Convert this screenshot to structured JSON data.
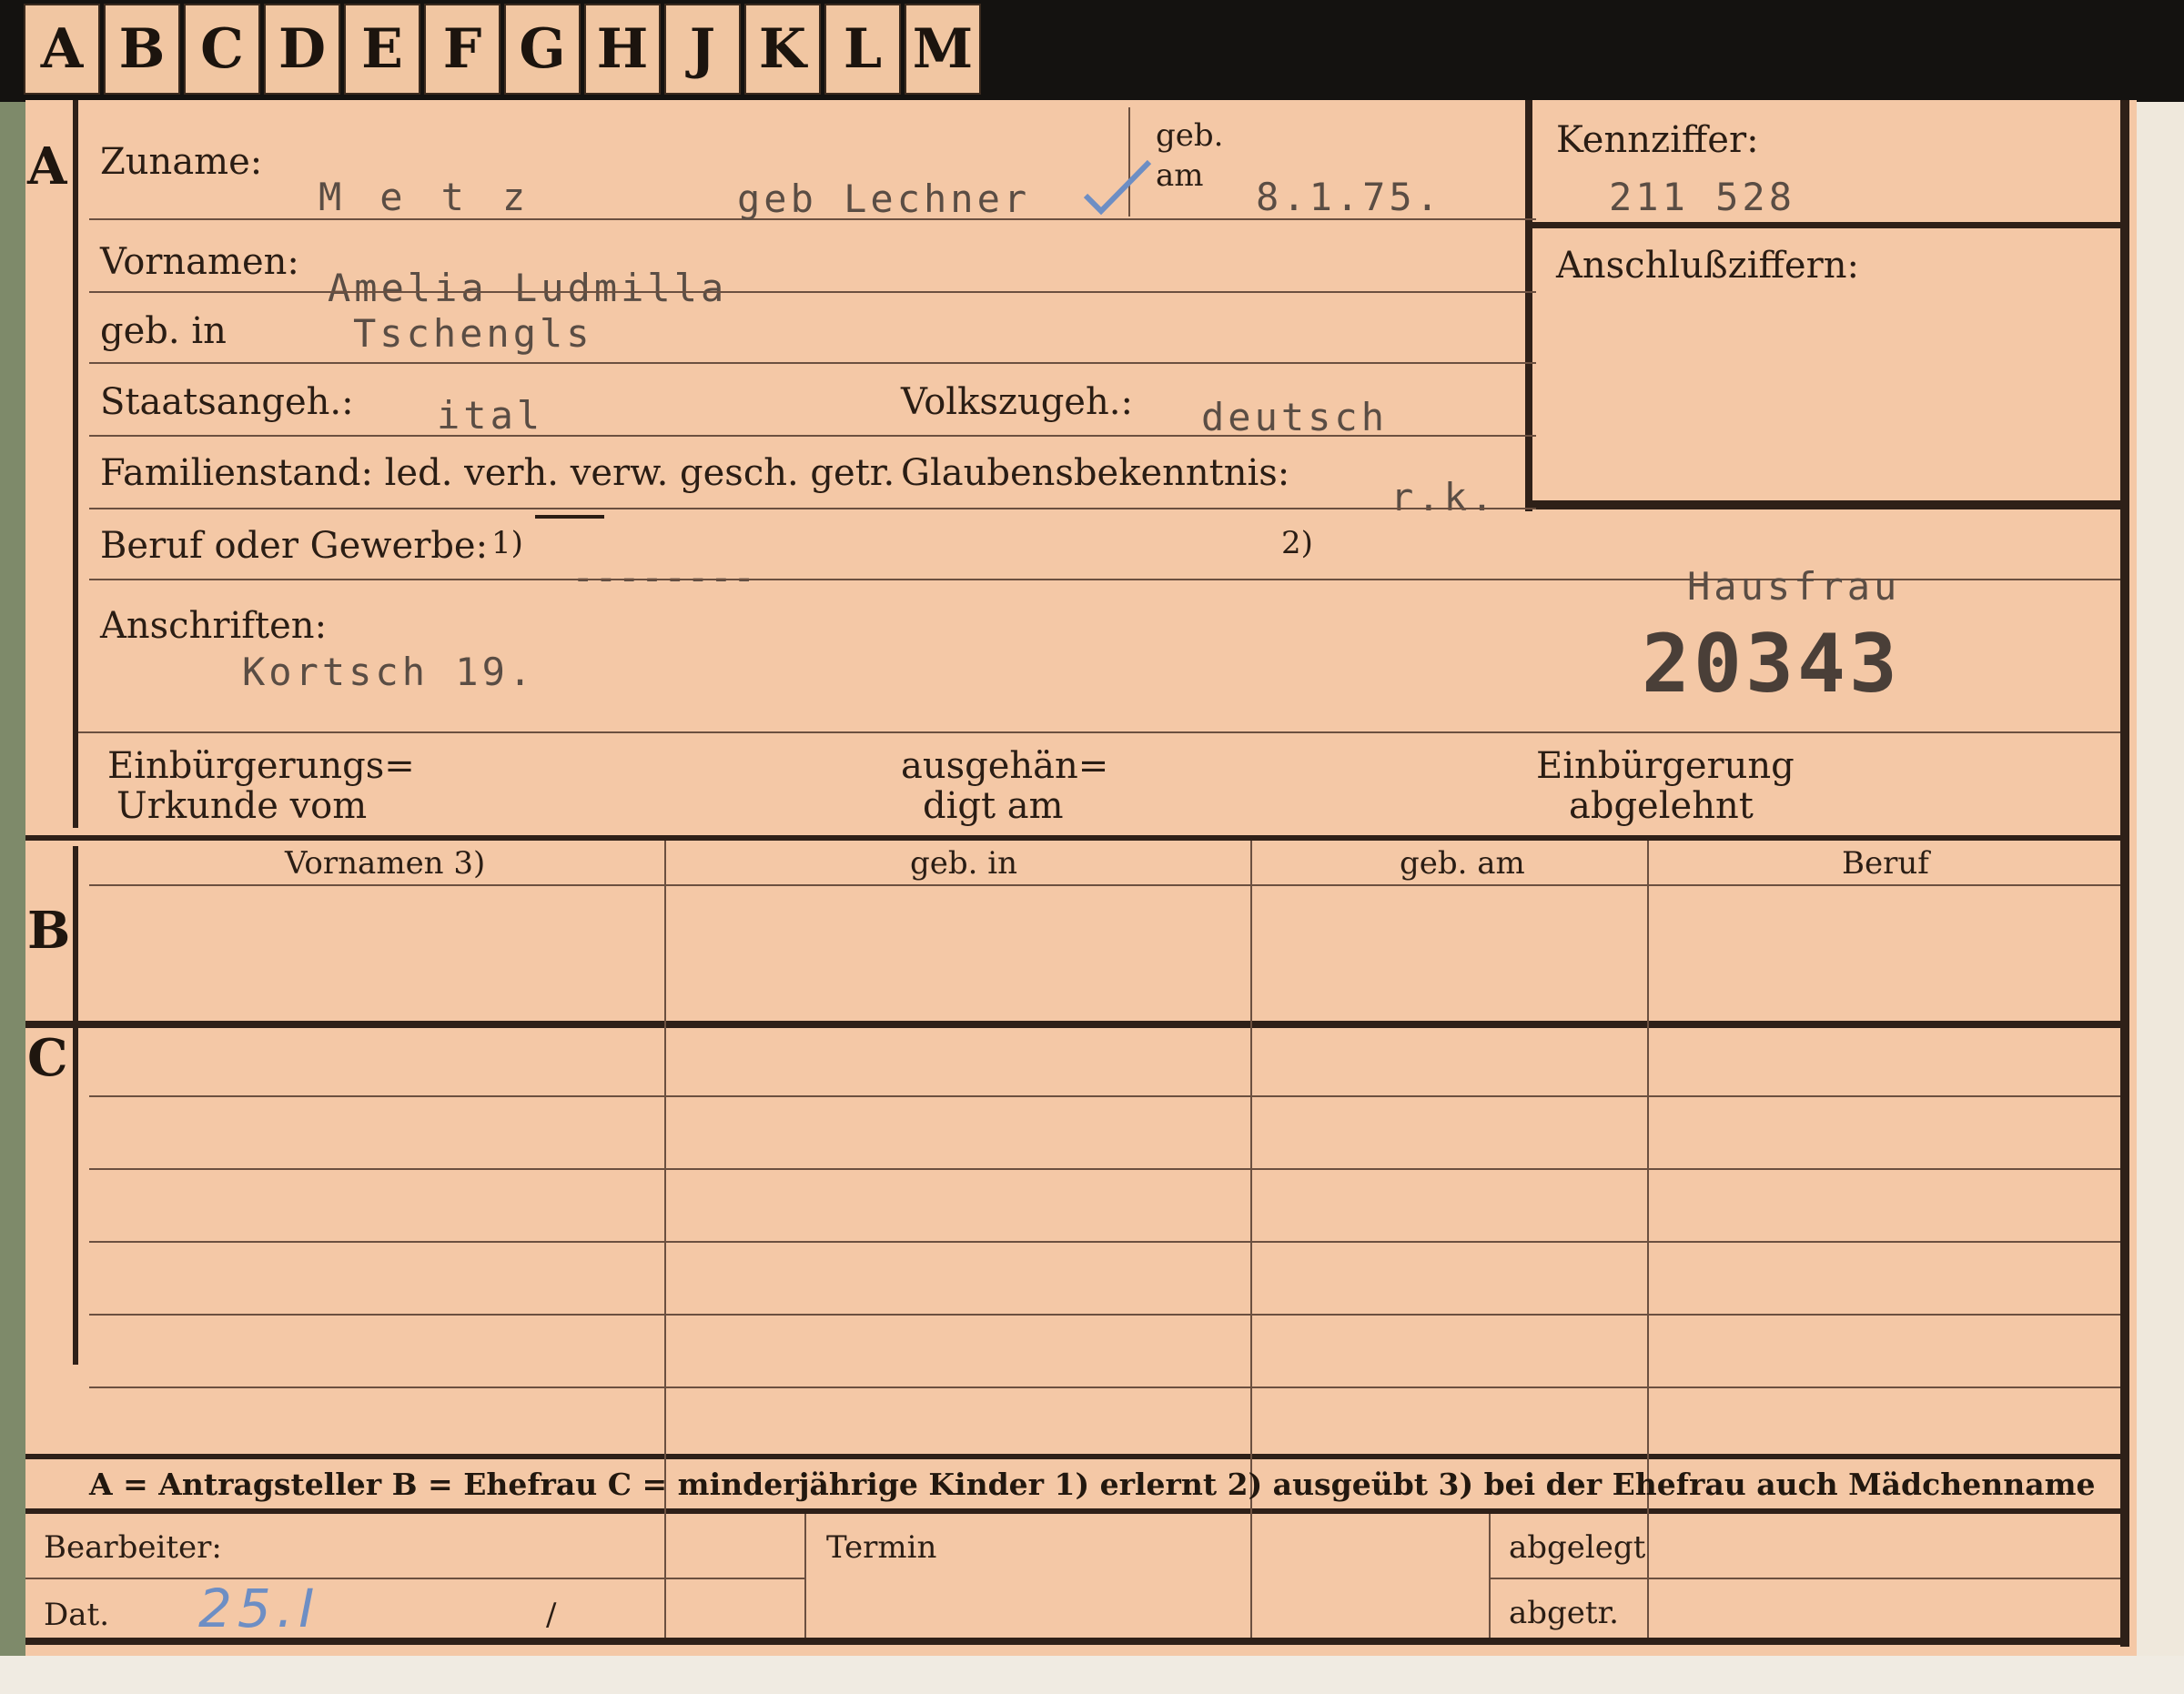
{
  "tabs": [
    "A",
    "B",
    "C",
    "D",
    "E",
    "F",
    "G",
    "H",
    "J",
    "K",
    "L",
    "M"
  ],
  "section_labels": {
    "a": "A",
    "b": "B",
    "c": "C"
  },
  "form": {
    "zuname_label": "Zuname:",
    "geb_label": "geb.",
    "am_label": "am",
    "vornamen_label": "Vornamen:",
    "geb_in_label": "geb. in",
    "staatsangeh_label": "Staatsangeh.:",
    "volkszugeh_label": "Volkszugeh.:",
    "familienstand_label": "Familienstand: led. verh. verw. gesch. getr.",
    "glaubens_label": "Glaubensbekenntnis:",
    "beruf_label": "Beruf oder Gewerbe:",
    "beruf_note1": "1)",
    "beruf_note2": "2)",
    "anschriften_label": "Anschriften:",
    "einb_urkunde_l1": "Einbürgerungs=",
    "einb_urkunde_l2": "Urkunde vom",
    "ausgehaen_l1": "ausgehän=",
    "ausgehaen_l2": "digt am",
    "einb_abgelehnt_l1": "Einbürgerung",
    "einb_abgelehnt_l2": "abgelehnt",
    "kennziffer_label": "Kennziffer:",
    "anschluss_label": "Anschlußziffern:"
  },
  "values": {
    "zuname": "Metz",
    "geb_name": "geb Lechner",
    "geb_am": "8.1.75.",
    "vornamen": "Amelia Ludmilla",
    "geb_in": "Tschengls",
    "staatsangeh": "ital",
    "volkszugeh": "deutsch",
    "glaubens": "r.k.",
    "beruf_dashes": "--------",
    "beruf2": "Hausfrau",
    "anschrift": "Kortsch 19.",
    "stamp_number": "20343",
    "kennziffer": "211 528"
  },
  "table": {
    "headers": [
      "Vornamen 3)",
      "geb. in",
      "geb. am",
      "Beruf"
    ]
  },
  "legend": "A = Antragsteller   B = Ehefrau   C = minderjährige Kinder   1) erlernt   2) ausgeübt   3) bei der Ehefrau auch Mädchenname",
  "footer": {
    "bearbeiter_label": "Bearbeiter:",
    "termin_label": "Termin",
    "abgelegt_label": "abgelegt",
    "dat_label": "Dat.",
    "abgetr_label": "abgetr.",
    "dat_value": "25.I",
    "dat_slash": "/"
  },
  "colors": {
    "card": "#f4c8a6",
    "ink": "#2a1d14",
    "typewriter": "#5a4d44",
    "pencil": "#6d8ec4"
  }
}
